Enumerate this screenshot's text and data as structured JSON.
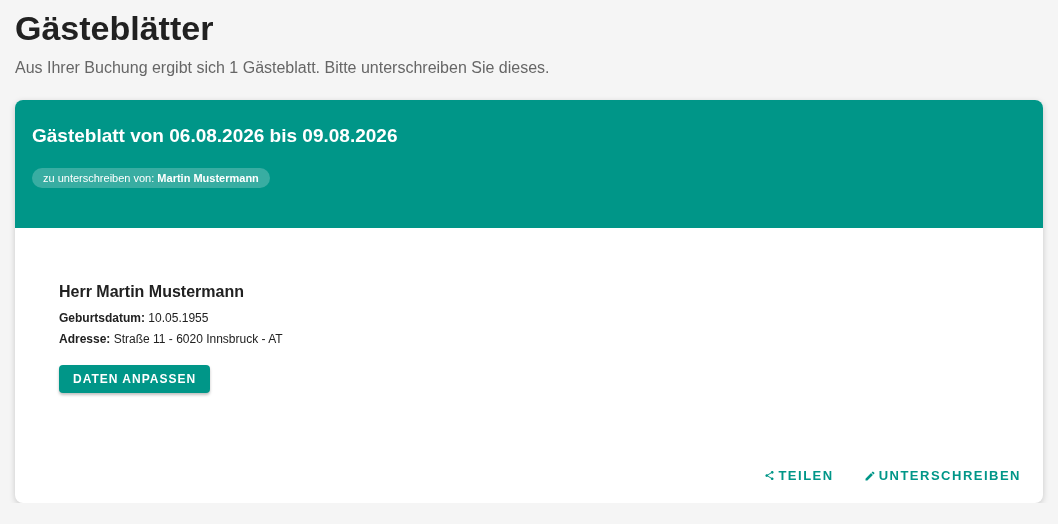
{
  "page": {
    "title": "Gästeblätter",
    "subtitle": "Aus Ihrer Buchung ergibt sich 1 Gästeblatt. Bitte unterschreiben Sie dieses."
  },
  "card": {
    "title": "Gästeblatt von 06.08.2026 bis 09.08.2026",
    "signer_chip": "zu unterschreiben von: **Martin Mustermann**",
    "guest": {
      "name": "Herr Martin Mustermann",
      "details": [
        "**Geburtsdatum:** 10.05.1955",
        "**Adresse:** Straße 11 - 6020 Innsbruck - AT"
      ],
      "button": "DATEN ANPASSEN"
    },
    "actions": [
      {
        "kind": "share",
        "label": "TEILEN"
      },
      {
        "kind": "sign",
        "label": "UNTERSCHREIBEN"
      }
    ]
  }
}
